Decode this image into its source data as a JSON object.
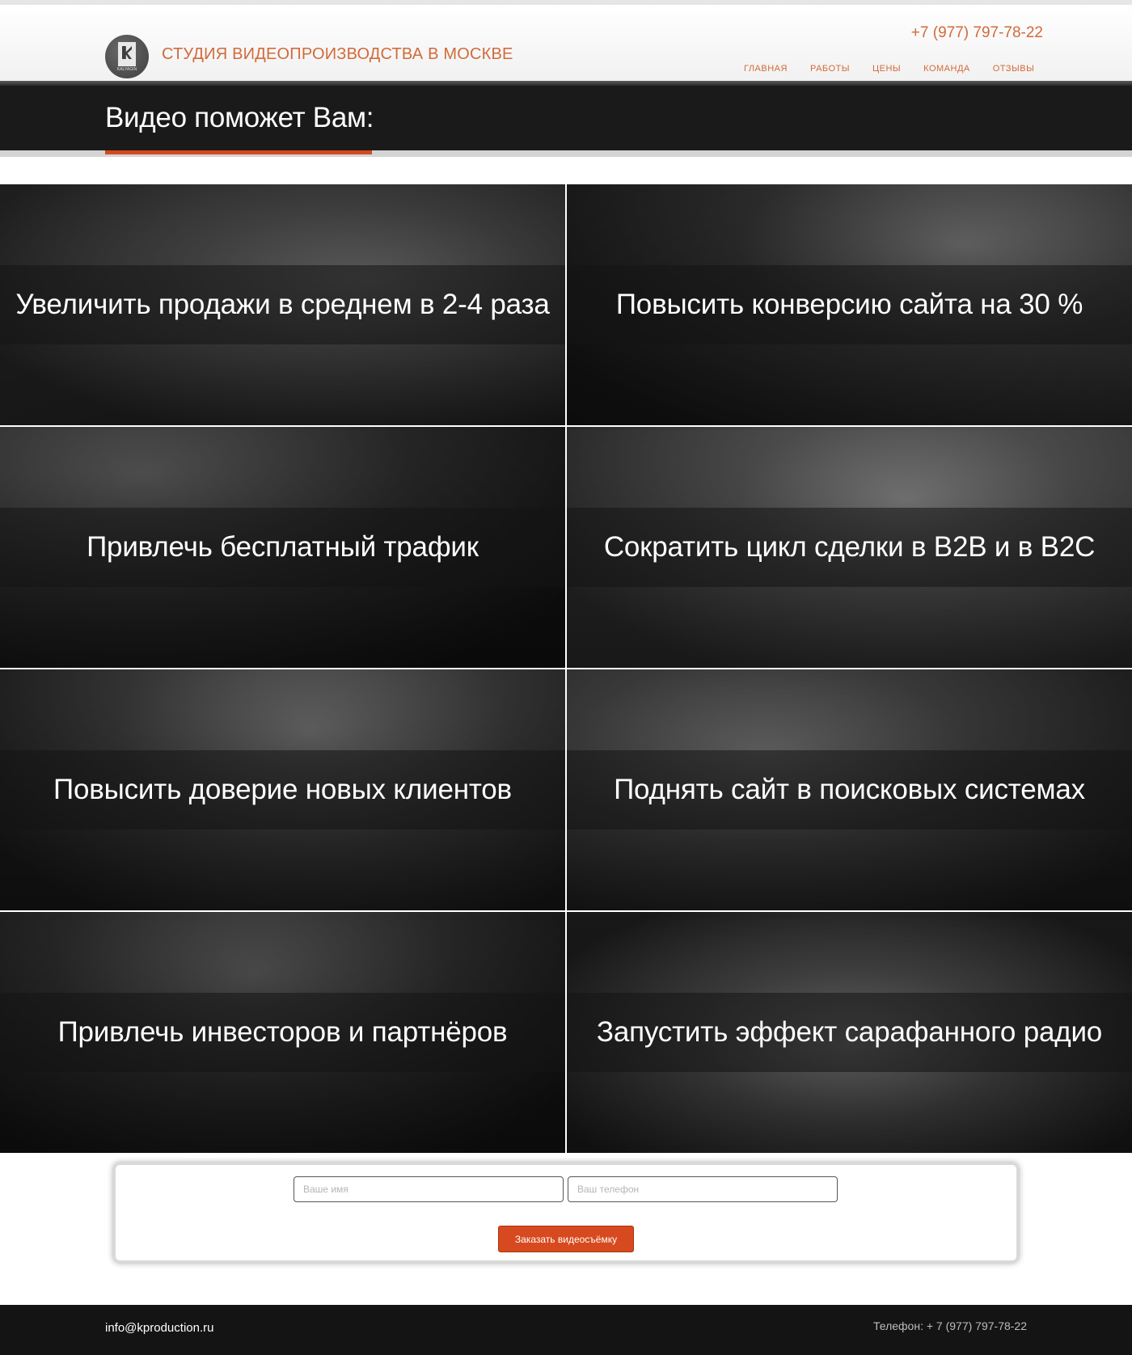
{
  "header": {
    "brand": "СТУДИЯ ВИДЕОПРОИЗВОДСТВА В МОСКВЕ",
    "logo_text": "KALYAGIN",
    "phone": "+7 (977) 797-78-22",
    "nav": [
      {
        "label": "ГЛАВНАЯ"
      },
      {
        "label": "РАБОТЫ"
      },
      {
        "label": "ЦЕНЫ"
      },
      {
        "label": "КОМАНДА"
      },
      {
        "label": "ОТЗЫВЫ"
      }
    ]
  },
  "section": {
    "title": "Видео поможет Вам:"
  },
  "tiles": [
    {
      "label": "Увеличить продажи в среднем в 2-4 раза"
    },
    {
      "label": "Повысить конверсию сайта на 30 %"
    },
    {
      "label": "Привлечь бесплатный трафик"
    },
    {
      "label": "Сократить цикл сделки в B2B и в B2C"
    },
    {
      "label": "Повысить доверие новых клиентов"
    },
    {
      "label": "Поднять сайт в поисковых системах"
    },
    {
      "label": "Привлечь инвесторов и партнёров"
    },
    {
      "label": "Запустить эффект сарафанного радио"
    }
  ],
  "form": {
    "name_placeholder": "Ваше имя",
    "phone_placeholder": "Ваш телефон",
    "submit_label": "Заказать видеосъёмку"
  },
  "footer": {
    "email": "info@kproduction.ru",
    "phone": "Телефон: + 7 (977) 797-78-22"
  },
  "colors": {
    "accent": "#d26a3a",
    "button": "#d74a1f",
    "dark_band": "#1a1a1a",
    "footer": "#141414"
  }
}
